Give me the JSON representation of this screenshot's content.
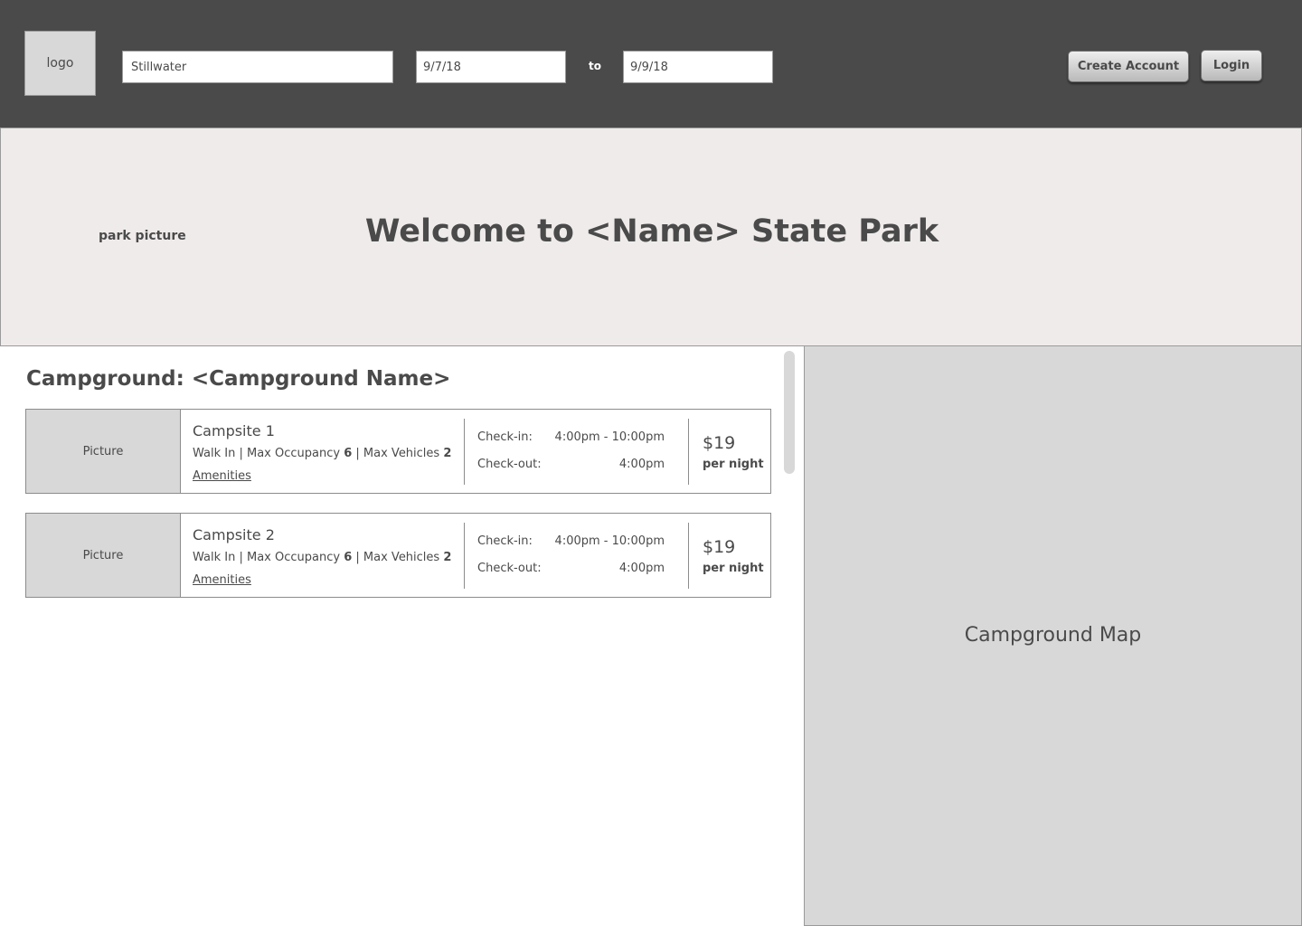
{
  "header": {
    "logo_label": "logo",
    "search_value": "Stillwater",
    "start_date": "9/7/18",
    "to_label": "to",
    "end_date": "9/9/18",
    "create_account_label": "Create Account",
    "login_label": "Login"
  },
  "hero": {
    "picture_label": "park picture",
    "welcome_title": "Welcome to <Name> State Park"
  },
  "campground": {
    "title": "Campground: <Campground Name>",
    "sites": [
      {
        "picture_label": "Picture",
        "name": "Campsite 1",
        "type": "Walk In",
        "max_occupancy_label": "Max Occupancy",
        "max_occupancy": "6",
        "max_vehicles_label": "Max Vehicles",
        "max_vehicles": "2",
        "amenities_label": "Amenities",
        "checkin_label": "Check-in:",
        "checkin_time": "4:00pm - 10:00pm",
        "checkout_label": "Check-out:",
        "checkout_time": "4:00pm",
        "price": "$19",
        "price_unit": "per night"
      },
      {
        "picture_label": "Picture",
        "name": "Campsite 2",
        "type": "Walk In",
        "max_occupancy_label": "Max Occupancy",
        "max_occupancy": "6",
        "max_vehicles_label": "Max Vehicles",
        "max_vehicles": "2",
        "amenities_label": "Amenities",
        "checkin_label": "Check-in:",
        "checkin_time": "4:00pm - 10:00pm",
        "checkout_label": "Check-out:",
        "checkout_time": "4:00pm",
        "price": "$19",
        "price_unit": "per night"
      }
    ]
  },
  "map": {
    "label": "Campground Map"
  },
  "colors": {
    "header_bg": "#4a4a4a",
    "hero_bg": "#f0ebeb",
    "placeholder_gray": "#d8d8d8",
    "text": "#4a4a4a"
  }
}
